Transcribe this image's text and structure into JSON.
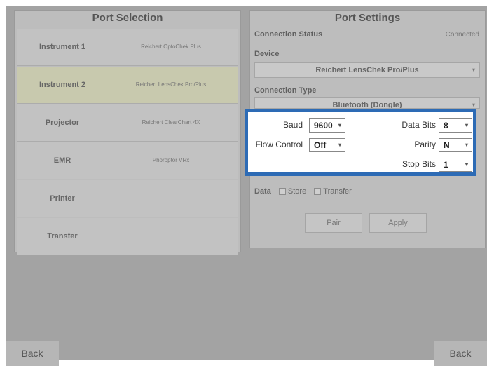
{
  "port_selection": {
    "title": "Port Selection",
    "rows": [
      {
        "name": "Instrument 1",
        "device": "Reichert OptoChek Plus"
      },
      {
        "name": "Instrument 2",
        "device": "Reichert LensChek Pro/Plus"
      },
      {
        "name": "Projector",
        "device": "Reichert ClearChart 4X"
      },
      {
        "name": "EMR",
        "device": "Phoroptor VRx"
      },
      {
        "name": "Printer",
        "device": ""
      },
      {
        "name": "Transfer",
        "device": ""
      }
    ]
  },
  "port_settings": {
    "title": "Port Settings",
    "connection_status_label": "Connection Status",
    "connection_status_value": "Connected",
    "device_label": "Device",
    "device_value": "Reichert LensChek Pro/Plus",
    "connection_type_label": "Connection Type",
    "connection_type_value": "Bluetooth (Dongle)",
    "baud_label": "Baud",
    "baud_value": "9600",
    "flow_control_label": "Flow Control",
    "flow_control_value": "Off",
    "data_bits_label": "Data Bits",
    "data_bits_value": "8",
    "parity_label": "Parity",
    "parity_value": "N",
    "stop_bits_label": "Stop Bits",
    "stop_bits_value": "1",
    "data_label": "Data",
    "store_label": "Store",
    "transfer_label": "Transfer",
    "pair_label": "Pair",
    "apply_label": "Apply"
  },
  "footer": {
    "back_left": "Back",
    "back_right": "Back"
  },
  "colors": {
    "highlight_border": "#2d6bb5",
    "selected_row": "#c8c9ae"
  }
}
